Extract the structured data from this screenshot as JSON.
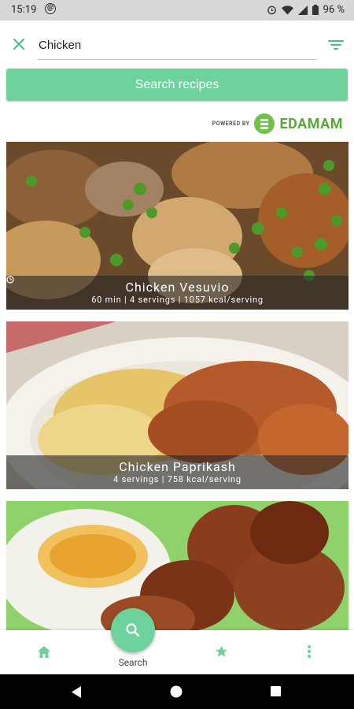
{
  "status": {
    "time": "15:19",
    "battery": "96 %"
  },
  "search": {
    "value": "Chicken",
    "button_label": "Search recipes"
  },
  "powered_by": {
    "small": "POWERED BY",
    "brand": "EDAMAM"
  },
  "recipes": [
    {
      "title": "Chicken Vesuvio",
      "meta": "60 min | 4 servings | 1057 kcal/serving"
    },
    {
      "title": "Chicken Paprikash",
      "meta": "4 servings | 758 kcal/serving"
    },
    {
      "title": "",
      "meta": ""
    }
  ],
  "nav": {
    "search_label": "Search"
  },
  "colors": {
    "accent": "#6ed29c",
    "brand": "#6fc14b"
  }
}
